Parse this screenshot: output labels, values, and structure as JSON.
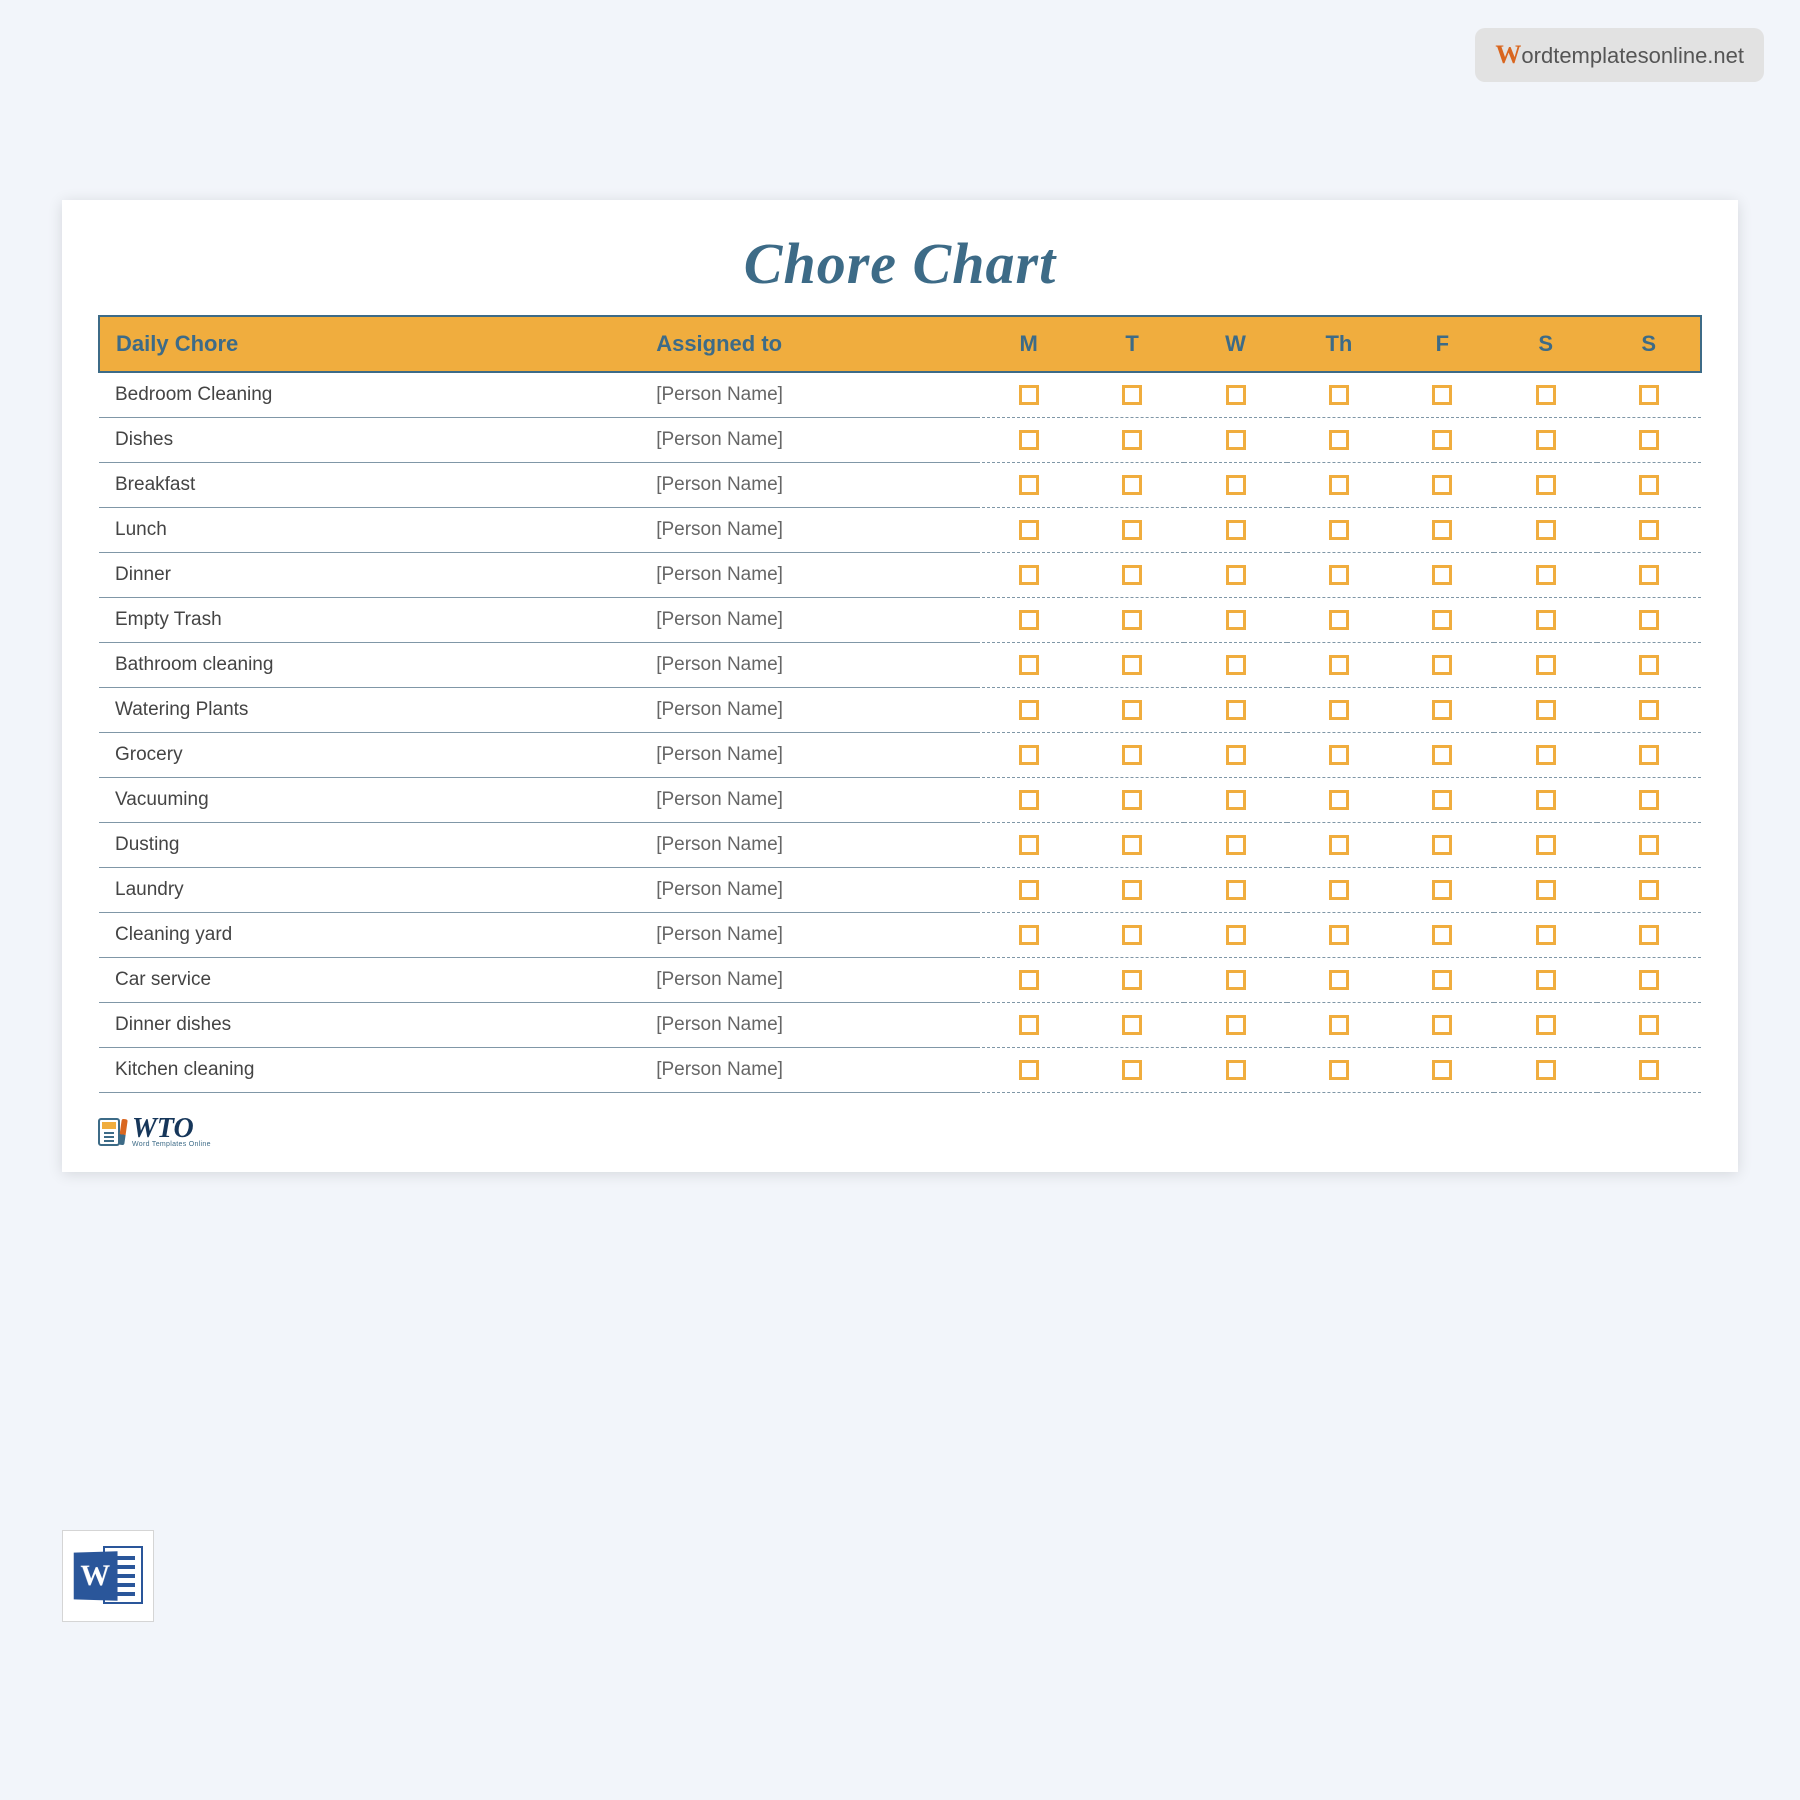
{
  "watermark": {
    "first_letter": "W",
    "rest": "ordtemplatesonline.net"
  },
  "title": "Chore Chart",
  "headers": {
    "chore": "Daily Chore",
    "assigned": "Assigned to",
    "days": [
      "M",
      "T",
      "W",
      "Th",
      "F",
      "S",
      "S"
    ]
  },
  "placeholder_assigned": "[Person Name]",
  "chores": [
    {
      "name": "Bedroom Cleaning"
    },
    {
      "name": "Dishes"
    },
    {
      "name": "Breakfast"
    },
    {
      "name": "Lunch"
    },
    {
      "name": "Dinner"
    },
    {
      "name": "Empty Trash"
    },
    {
      "name": "Bathroom cleaning"
    },
    {
      "name": "Watering Plants"
    },
    {
      "name": "Grocery"
    },
    {
      "name": "Vacuuming"
    },
    {
      "name": "Dusting"
    },
    {
      "name": "Laundry"
    },
    {
      "name": "Cleaning yard"
    },
    {
      "name": "Car service"
    },
    {
      "name": "Dinner dishes"
    },
    {
      "name": "Kitchen cleaning"
    }
  ],
  "logo": {
    "text": "WTO",
    "subtitle": "Word Templates Online"
  },
  "word_icon_letter": "W"
}
